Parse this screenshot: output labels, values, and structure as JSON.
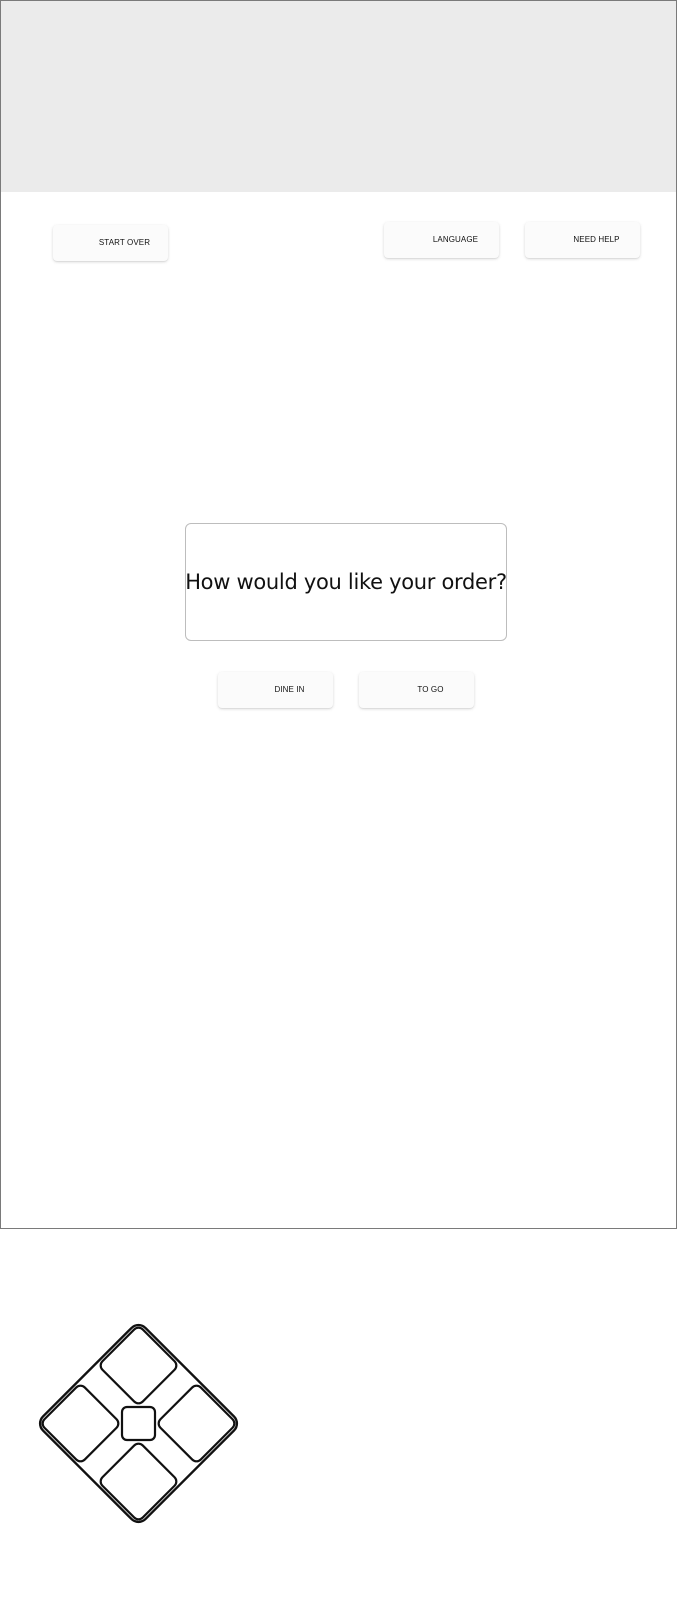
{
  "header": {
    "start_over_label": "START OVER",
    "language_label": "LANGUAGE",
    "need_help_label": "NEED HELP"
  },
  "main": {
    "prompt": "How would you like your order?",
    "dine_in_label": "DINE IN",
    "to_go_label": "TO GO"
  },
  "colors": {
    "header_band": "#ebebeb",
    "button_bg": "#fbfbfb",
    "frame_border": "#7a7a7a"
  },
  "icons": {
    "logo": "four-panel-diamond-logo"
  }
}
